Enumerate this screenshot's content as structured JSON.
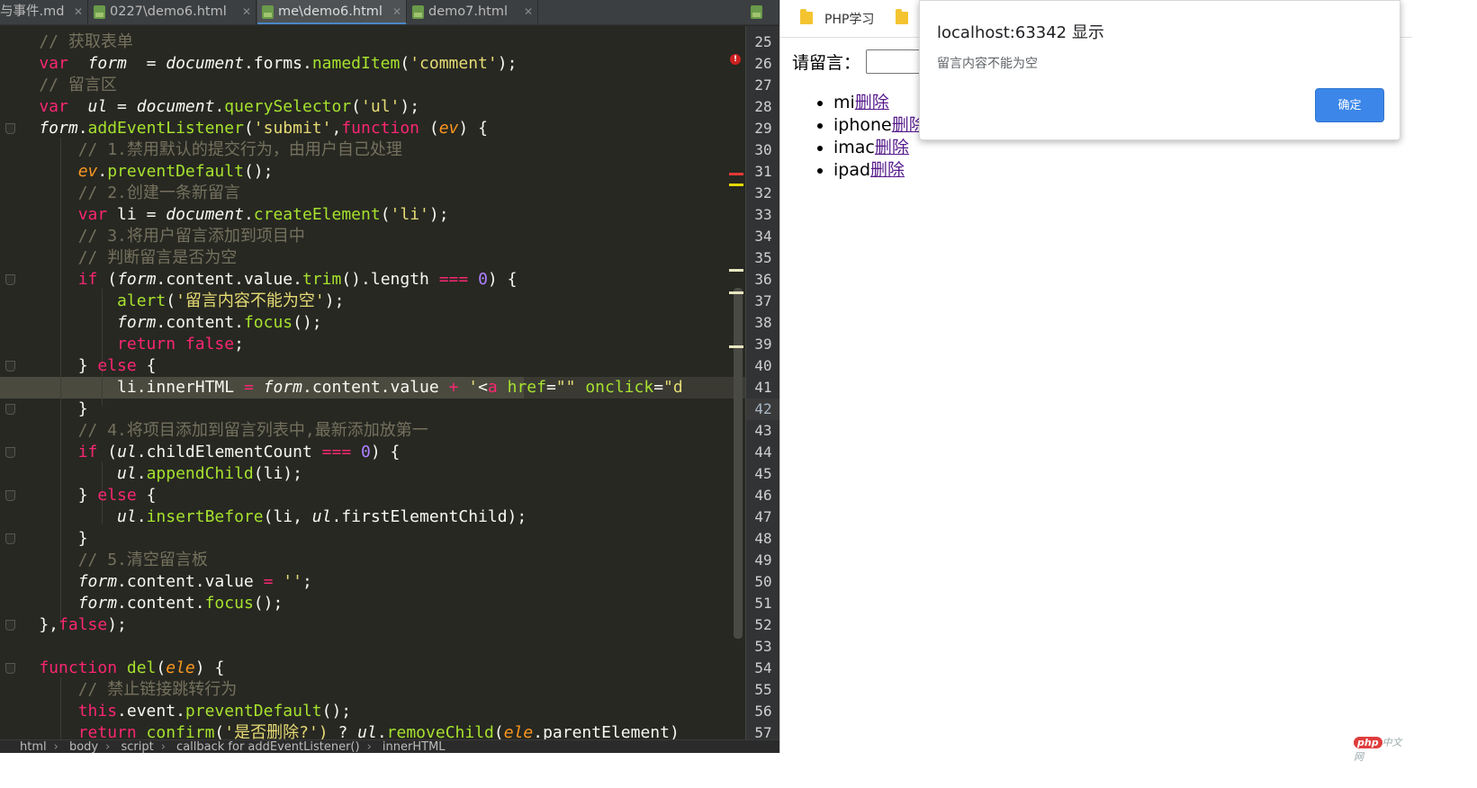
{
  "tabs": [
    {
      "label": "与事件.md",
      "icon": "markdown-icon",
      "active": false
    },
    {
      "label": "0227\\demo6.html",
      "icon": "html-file-icon",
      "active": false
    },
    {
      "label": "me\\demo6.html",
      "icon": "html-file-icon",
      "active": true
    },
    {
      "label": "demo7.html",
      "icon": "html-file-icon",
      "active": false
    }
  ],
  "editor": {
    "first_line": 25,
    "current_line": 42,
    "lines": [
      [
        [
          "cm",
          "    // 获取表单"
        ]
      ],
      [
        [
          "kw",
          "    var "
        ],
        [
          "it",
          " form"
        ],
        [
          "",
          "  = "
        ],
        [
          "it",
          "document"
        ],
        [
          "",
          ".forms."
        ],
        [
          "fn",
          "namedItem"
        ],
        [
          "",
          "("
        ],
        [
          "st",
          "'comment'"
        ],
        [
          "",
          ");"
        ]
      ],
      [
        [
          "cm",
          "    // 留言区"
        ]
      ],
      [
        [
          "kw",
          "    var "
        ],
        [
          "it",
          " ul"
        ],
        [
          "",
          " = "
        ],
        [
          "it",
          "document"
        ],
        [
          "",
          "."
        ],
        [
          "fn",
          "querySelector"
        ],
        [
          "",
          "("
        ],
        [
          "st",
          "'ul'"
        ],
        [
          "",
          ");"
        ]
      ],
      [
        [
          "it",
          "    form"
        ],
        [
          "",
          "."
        ],
        [
          "fn",
          "addEventListener"
        ],
        [
          "",
          "("
        ],
        [
          "st",
          "'submit'"
        ],
        [
          "",
          ","
        ],
        [
          "kw",
          "function"
        ],
        [
          "",
          " ("
        ],
        [
          "pa",
          "ev"
        ],
        [
          "",
          ") {"
        ]
      ],
      [
        [
          "cm",
          "        // 1.禁用默认的提交行为，由用户自己处理"
        ]
      ],
      [
        [
          "pa",
          "        ev"
        ],
        [
          "",
          "."
        ],
        [
          "fn",
          "preventDefault"
        ],
        [
          "",
          "();"
        ]
      ],
      [
        [
          "cm",
          "        // 2.创建一条新留言"
        ]
      ],
      [
        [
          "kw",
          "        var"
        ],
        [
          "",
          " li = "
        ],
        [
          "it",
          "document"
        ],
        [
          "",
          "."
        ],
        [
          "fn",
          "createElement"
        ],
        [
          "",
          "("
        ],
        [
          "st",
          "'li'"
        ],
        [
          "",
          ");"
        ]
      ],
      [
        [
          "cm",
          "        // 3.将用户留言添加到项目中"
        ]
      ],
      [
        [
          "cm",
          "        // 判断留言是否为空"
        ]
      ],
      [
        [
          "kw",
          "        if"
        ],
        [
          "",
          " ("
        ],
        [
          "it",
          "form"
        ],
        [
          "",
          ".content.value."
        ],
        [
          "fn",
          "trim"
        ],
        [
          "",
          "().length "
        ],
        [
          "kw",
          "==="
        ],
        [
          "",
          " "
        ],
        [
          "nm",
          "0"
        ],
        [
          "",
          ") {"
        ]
      ],
      [
        [
          "fn",
          "            alert"
        ],
        [
          "",
          "("
        ],
        [
          "st",
          "'留言内容不能为空'"
        ],
        [
          "",
          ");"
        ]
      ],
      [
        [
          "it",
          "            form"
        ],
        [
          "",
          ".content."
        ],
        [
          "fn",
          "focus"
        ],
        [
          "",
          "();"
        ]
      ],
      [
        [
          "kw",
          "            return false"
        ],
        [
          "",
          ";"
        ]
      ],
      [
        [
          "",
          "        } "
        ],
        [
          "kw",
          "else"
        ],
        [
          "",
          " {"
        ]
      ],
      [
        [
          "",
          "            li.innerHTML "
        ],
        [
          "kw",
          "="
        ],
        [
          "",
          " "
        ],
        [
          "it",
          "form"
        ],
        [
          "",
          ".content.value "
        ],
        [
          "kw",
          "+"
        ],
        [
          "",
          " "
        ],
        [
          "st",
          "'"
        ],
        [
          "",
          "<"
        ],
        [
          "kw",
          "a"
        ],
        [
          "fn",
          " href"
        ],
        [
          "",
          "="
        ],
        [
          "st",
          "\"\""
        ],
        [
          "fn",
          " onclick"
        ],
        [
          "",
          "="
        ],
        [
          "st",
          "\"d"
        ]
      ],
      [
        [
          "",
          "        }"
        ]
      ],
      [
        [
          "cm",
          "        // 4.将项目添加到留言列表中,最新添加放第一"
        ]
      ],
      [
        [
          "kw",
          "        if"
        ],
        [
          "",
          " ("
        ],
        [
          "it",
          "ul"
        ],
        [
          "",
          ".childElementCount "
        ],
        [
          "kw",
          "==="
        ],
        [
          "",
          " "
        ],
        [
          "nm",
          "0"
        ],
        [
          "",
          ") {"
        ]
      ],
      [
        [
          "it",
          "            ul"
        ],
        [
          "",
          "."
        ],
        [
          "fn",
          "appendChild"
        ],
        [
          "",
          "(li);"
        ]
      ],
      [
        [
          "",
          "        } "
        ],
        [
          "kw",
          "else"
        ],
        [
          "",
          " {"
        ]
      ],
      [
        [
          "it",
          "            ul"
        ],
        [
          "",
          "."
        ],
        [
          "fn",
          "insertBefore"
        ],
        [
          "",
          "(li, "
        ],
        [
          "it",
          "ul"
        ],
        [
          "",
          ".firstElementChild);"
        ]
      ],
      [
        [
          "",
          "        }"
        ]
      ],
      [
        [
          "cm",
          "        // 5.清空留言板"
        ]
      ],
      [
        [
          "it",
          "        form"
        ],
        [
          "",
          ".content.value "
        ],
        [
          "kw",
          "="
        ],
        [
          "",
          " "
        ],
        [
          "st",
          "''"
        ],
        [
          "",
          ";"
        ]
      ],
      [
        [
          "it",
          "        form"
        ],
        [
          "",
          ".content."
        ],
        [
          "fn",
          "focus"
        ],
        [
          "",
          "();"
        ]
      ],
      [
        [
          "",
          "    },"
        ],
        [
          "kw",
          "false"
        ],
        [
          "",
          ");"
        ]
      ],
      [
        [
          "",
          ""
        ]
      ],
      [
        [
          "kw",
          "    function"
        ],
        [
          "fn",
          " del"
        ],
        [
          "",
          "("
        ],
        [
          "pa",
          "ele"
        ],
        [
          "",
          ") {"
        ]
      ],
      [
        [
          "cm",
          "        // 禁止链接跳转行为"
        ]
      ],
      [
        [
          "kw",
          "        this"
        ],
        [
          "",
          ".event."
        ],
        [
          "fn",
          "preventDefault"
        ],
        [
          "",
          "();"
        ]
      ],
      [
        [
          "kw",
          "        return"
        ],
        [
          "fn",
          " confirm"
        ],
        [
          "",
          "("
        ],
        [
          "st",
          "'是否删除?')"
        ],
        [
          "",
          " ? "
        ],
        [
          "it",
          "ul"
        ],
        [
          "",
          "."
        ],
        [
          "fn",
          "removeChild"
        ],
        [
          "",
          "("
        ],
        [
          "pa",
          "ele"
        ],
        [
          "",
          ".parentElement)"
        ]
      ]
    ]
  },
  "breadcrumb": [
    "html",
    "body",
    "script",
    "callback for addEventListener()",
    "innerHTML"
  ],
  "browser": {
    "bookmark": "PHP学习",
    "form_label": "请留言：",
    "input_value": "",
    "items": [
      {
        "text": "mi",
        "link": "删除"
      },
      {
        "text": "iphone",
        "link": "删除"
      },
      {
        "text": "imac",
        "link": "删除"
      },
      {
        "text": "ipad",
        "link": "删除"
      }
    ]
  },
  "dialog": {
    "title": "localhost:63342 显示",
    "message": "留言内容不能为空",
    "ok_label": "确定"
  },
  "watermark": {
    "badge": "php",
    "text": "中文网"
  },
  "colors": {
    "editor_bg": "#272822",
    "keyword": "#f92672",
    "function": "#a6e22e",
    "string": "#e6db74",
    "comment": "#75715e",
    "number": "#ae81ff",
    "dialog_button": "#3b86e8",
    "link": "#551a8b"
  }
}
